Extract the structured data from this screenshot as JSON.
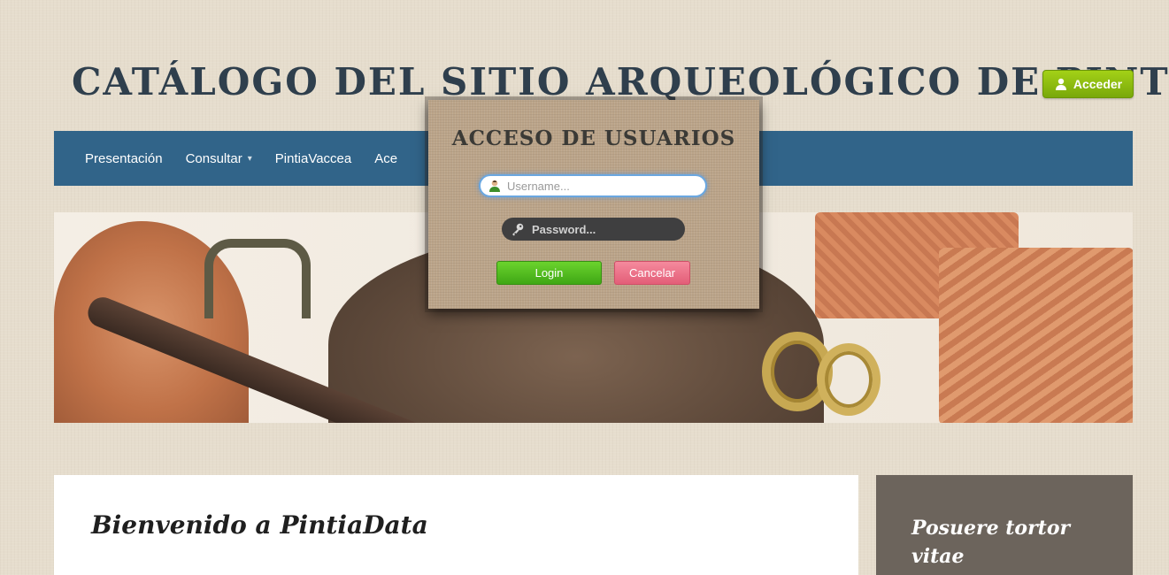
{
  "header": {
    "site_title": "CATÁLOGO DEL SITIO ARQUEOLÓGICO DE PINTIA",
    "login_button_label": "Acceder"
  },
  "nav": {
    "items": [
      {
        "label": "Presentación",
        "has_dropdown": false
      },
      {
        "label": "Consultar",
        "has_dropdown": true
      },
      {
        "label": "PintiaVaccea",
        "has_dropdown": false
      },
      {
        "label": "Ace",
        "has_dropdown": false
      }
    ]
  },
  "modal": {
    "title": "ACCESO DE USUARIOS",
    "username_placeholder": "Username...",
    "password_placeholder": "Password...",
    "login_label": "Login",
    "cancel_label": "Cancelar"
  },
  "main": {
    "welcome_title": "Bienvenido a PintiaData"
  },
  "sidebar": {
    "title": "Posuere tortor vitae"
  },
  "colors": {
    "nav_bg": "#316489",
    "accent_green": "#8bbf11",
    "login_green": "#4cbc1e",
    "cancel_pink": "#ec6f88",
    "title_color": "#2f3f4d",
    "sidebar_bg": "#6c645c"
  },
  "icons": {
    "acceder_icon": "user-icon",
    "username_icon": "user-icon",
    "password_icon": "key-icon",
    "dropdown_icon": "caret-down-icon"
  }
}
